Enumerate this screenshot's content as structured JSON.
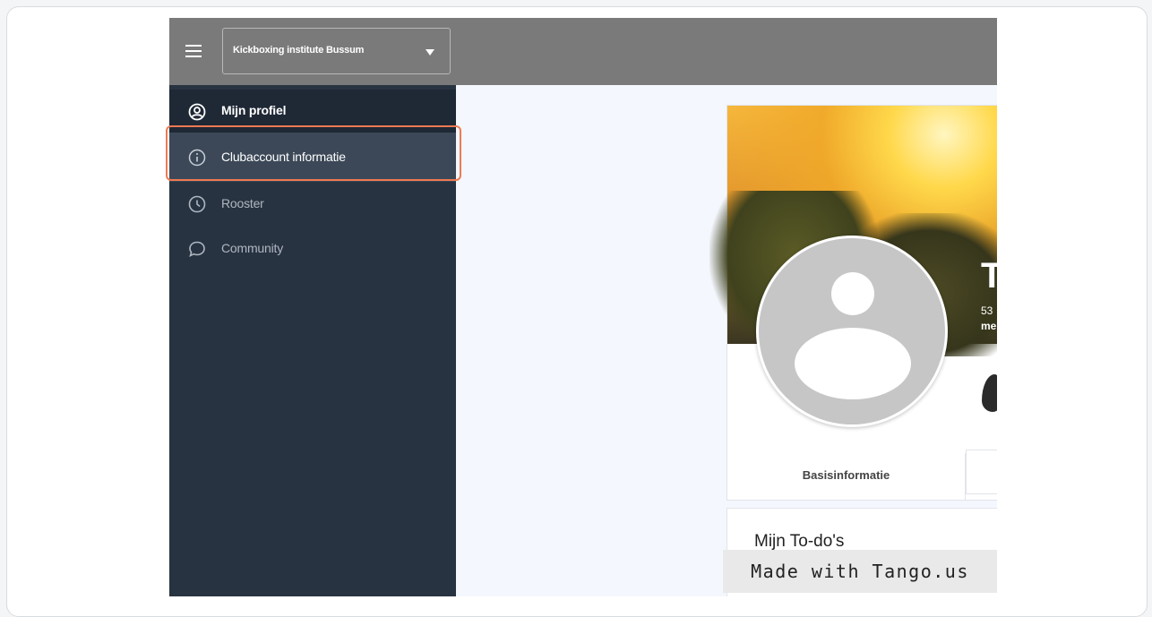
{
  "topbar": {
    "menu_icon": "hamburger-icon",
    "club_select": {
      "selected": "Kickboxing institute Bussum",
      "caret_icon": "caret-down-icon"
    },
    "background": "#7a7a7a"
  },
  "sidebar": {
    "background": "#283341",
    "items": [
      {
        "label": "Mijn profiel",
        "icon": "user-circle-icon",
        "active": true
      },
      {
        "label": "Clubaccount informatie",
        "icon": "info-circle-icon",
        "highlighted": true
      },
      {
        "label": "Rooster",
        "icon": "clock-icon"
      },
      {
        "label": "Community",
        "icon": "chat-bubble-icon"
      }
    ]
  },
  "profile": {
    "cover_title": "T",
    "cover_number": "53",
    "cover_sub": "me",
    "avatar_icon": "default-avatar-icon",
    "tabs": [
      {
        "label": "Basisinformatie"
      }
    ]
  },
  "todo": {
    "title": "Mijn To-do's"
  },
  "watermark": {
    "text": "Made with Tango.us"
  },
  "colors": {
    "highlight": "#ee7a52",
    "sidebar": "#283341",
    "active_item": "#3c4857"
  }
}
